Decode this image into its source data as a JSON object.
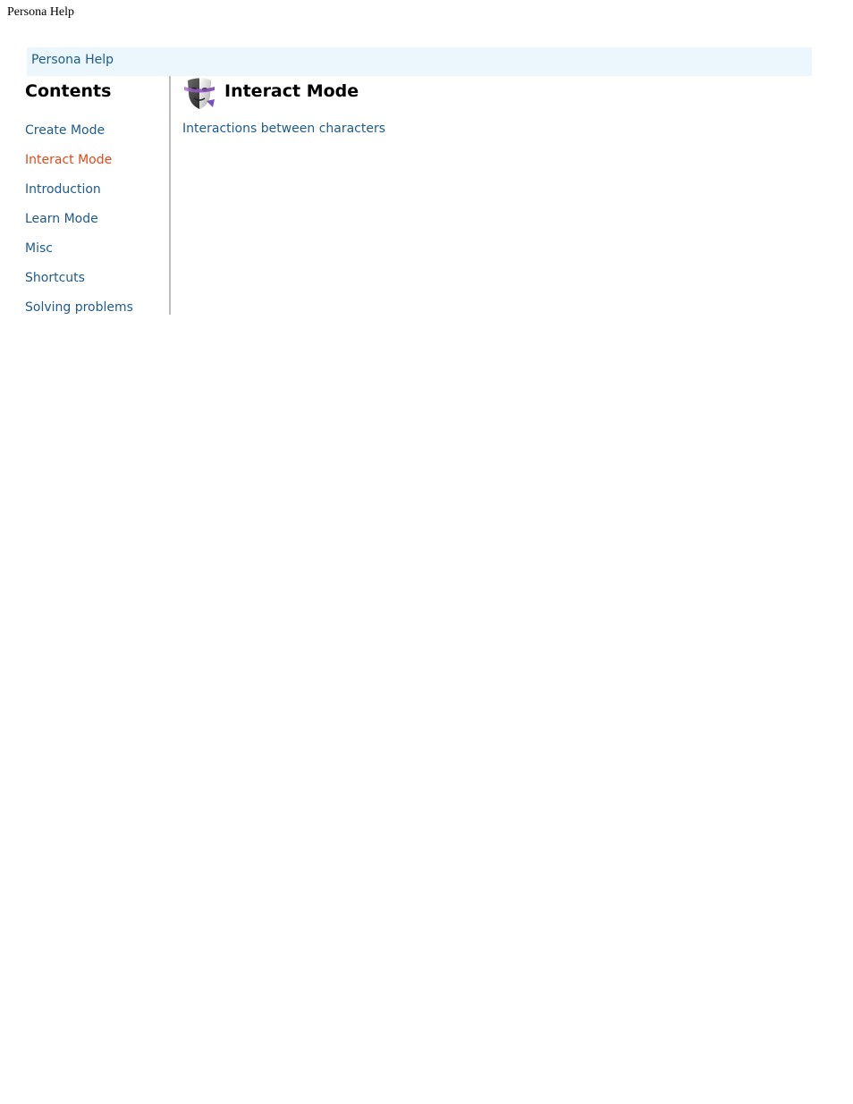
{
  "window": {
    "title": "Persona Help"
  },
  "breadcrumb": {
    "label": "Persona Help"
  },
  "sidebar": {
    "heading": "Contents",
    "items": [
      {
        "label": "Create Mode",
        "active": false
      },
      {
        "label": "Interact Mode",
        "active": true
      },
      {
        "label": "Introduction",
        "active": false
      },
      {
        "label": "Learn Mode",
        "active": false
      },
      {
        "label": "Misc",
        "active": false
      },
      {
        "label": "Shortcuts",
        "active": false
      },
      {
        "label": "Solving problems",
        "active": false
      }
    ]
  },
  "main": {
    "icon": "theater-mask-icon",
    "title": "Interact Mode",
    "links": [
      {
        "label": "Interactions between characters"
      }
    ]
  },
  "colors": {
    "link": "#1d5b8e",
    "active_link": "#e24a17",
    "breadcrumb_bg": "#ebf6fd",
    "divider": "#bdbdbd"
  }
}
